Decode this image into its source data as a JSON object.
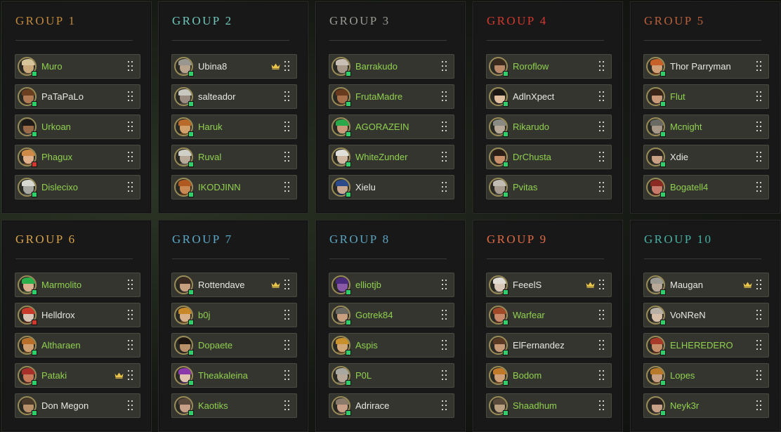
{
  "colors": {
    "online": "#2ed06a",
    "away": "#d03a2e",
    "name_green": "#8fd14f",
    "name_white": "#e8e8e2",
    "crown": "#e8c34a"
  },
  "groups": [
    {
      "title": "GROUP 1",
      "color": "#c0883a",
      "members": [
        {
          "name": "Muro",
          "highlight": true,
          "status": "online",
          "leader": false,
          "face": "#c9a97c",
          "hair": "#d8c49a",
          "body": "#5a4a36"
        },
        {
          "name": "PaTaPaLo",
          "highlight": false,
          "status": "online",
          "leader": false,
          "face": "#b07a54",
          "hair": "#6b3f22",
          "body": "#3a2e24"
        },
        {
          "name": "Urkoan",
          "highlight": true,
          "status": "online",
          "leader": false,
          "face": "#9a6a48",
          "hair": "#1e1a18",
          "body": "#3a3a3a"
        },
        {
          "name": "Phagux",
          "highlight": true,
          "status": "away",
          "leader": false,
          "face": "#e0b08a",
          "hair": "#d08a48",
          "body": "#6a4a2a"
        },
        {
          "name": "Dislecixo",
          "highlight": true,
          "status": "online",
          "leader": false,
          "face": "#a8a8a2",
          "hair": "#d8d8d2",
          "body": "#4a4a4a"
        }
      ]
    },
    {
      "title": "GROUP 2",
      "color": "#6fc6ba",
      "members": [
        {
          "name": "Ubina8",
          "highlight": false,
          "status": "online",
          "leader": true,
          "face": "#b8a48c",
          "hair": "#9a9690",
          "body": "#5a5248"
        },
        {
          "name": "salteador",
          "highlight": false,
          "status": "online",
          "leader": false,
          "face": "#9a8c80",
          "hair": "#c8c8c0",
          "body": "#4a4840"
        },
        {
          "name": "Haruk",
          "highlight": true,
          "status": "online",
          "leader": false,
          "face": "#d2a06a",
          "hair": "#b86a2a",
          "body": "#6a4a22"
        },
        {
          "name": "Ruval",
          "highlight": true,
          "status": "online",
          "leader": false,
          "face": "#b8a898",
          "hair": "#d0d0c8",
          "body": "#5a5850"
        },
        {
          "name": "IKODJINN",
          "highlight": true,
          "status": "online",
          "leader": false,
          "face": "#c88a52",
          "hair": "#b05a22",
          "body": "#6a3a1a"
        }
      ]
    },
    {
      "title": "GROUP 3",
      "color": "#9a9a94",
      "members": [
        {
          "name": "Barrakudo",
          "highlight": true,
          "status": "online",
          "leader": false,
          "face": "#a89888",
          "hair": "#c8c0b4",
          "body": "#4a443c"
        },
        {
          "name": "FrutaMadre",
          "highlight": true,
          "status": "online",
          "leader": false,
          "face": "#a8704a",
          "hair": "#6a3a1e",
          "body": "#4a3424"
        },
        {
          "name": "AGORAZEIN",
          "highlight": true,
          "status": "online",
          "leader": false,
          "face": "#c89a7a",
          "hair": "#2aa84a",
          "body": "#3a4a34"
        },
        {
          "name": "WhiteZunder",
          "highlight": true,
          "status": "online",
          "leader": false,
          "face": "#d0b8a0",
          "hair": "#e0e0da",
          "body": "#5a5a52"
        },
        {
          "name": "Xielu",
          "highlight": false,
          "status": "online",
          "leader": false,
          "face": "#c8a890",
          "hair": "#2a4a8a",
          "body": "#1e2e5a"
        }
      ]
    },
    {
      "title": "GROUP 4",
      "color": "#d3382e",
      "members": [
        {
          "name": "Roroflow",
          "highlight": true,
          "status": "online",
          "leader": false,
          "face": "#b88a6a",
          "hair": "#3a2a1e",
          "body": "#3a3230"
        },
        {
          "name": "AdlnXpect",
          "highlight": false,
          "status": "online",
          "leader": false,
          "face": "#e0c0a0",
          "hair": "#1a1614",
          "body": "#2a2624"
        },
        {
          "name": "Rikarudo",
          "highlight": true,
          "status": "online",
          "leader": false,
          "face": "#b8a898",
          "hair": "#8a8a84",
          "body": "#4a4a44"
        },
        {
          "name": "DrChusta",
          "highlight": true,
          "status": "online",
          "leader": false,
          "face": "#c8906a",
          "hair": "#2a1e16",
          "body": "#3a2a20"
        },
        {
          "name": "Pvitas",
          "highlight": true,
          "status": "online",
          "leader": false,
          "face": "#a89c90",
          "hair": "#c0bcb4",
          "body": "#4a4844"
        }
      ]
    },
    {
      "title": "GROUP 5",
      "color": "#b8603a",
      "members": [
        {
          "name": "Thor Parryman",
          "highlight": false,
          "status": "online",
          "leader": false,
          "face": "#d0a078",
          "hair": "#c8602a",
          "body": "#6a3a1a"
        },
        {
          "name": "Flut",
          "highlight": true,
          "status": "online",
          "leader": false,
          "face": "#c89a7a",
          "hair": "#3a2418",
          "body": "#3a2e26"
        },
        {
          "name": "Mcnight",
          "highlight": true,
          "status": "online",
          "leader": false,
          "face": "#a89888",
          "hair": "#6a6a64",
          "body": "#4a4640"
        },
        {
          "name": "Xdie",
          "highlight": false,
          "status": "online",
          "leader": false,
          "face": "#c8a084",
          "hair": "#2a2420",
          "body": "#3a3430"
        },
        {
          "name": "Bogatell4",
          "highlight": true,
          "status": "online",
          "leader": false,
          "face": "#c87a6a",
          "hair": "#8a2a22",
          "body": "#5a2420"
        }
      ]
    },
    {
      "title": "GROUP 6",
      "color": "#d8a24a",
      "members": [
        {
          "name": "Marmolito",
          "highlight": true,
          "status": "online",
          "leader": false,
          "face": "#d8b090",
          "hair": "#2ab04a",
          "body": "#4a5a3a"
        },
        {
          "name": "Helldrox",
          "highlight": false,
          "status": "away",
          "leader": false,
          "face": "#d8c4b4",
          "hair": "#c83a2a",
          "body": "#5a2a22"
        },
        {
          "name": "Altharaen",
          "highlight": true,
          "status": "online",
          "leader": false,
          "face": "#d0a070",
          "hair": "#b8702a",
          "body": "#6a4a24"
        },
        {
          "name": "Pataki",
          "highlight": true,
          "status": "online",
          "leader": true,
          "face": "#c87a5a",
          "hair": "#a8302a",
          "body": "#5a2a22"
        },
        {
          "name": "Don Megon",
          "highlight": false,
          "status": "online",
          "leader": false,
          "face": "#b8906a",
          "hair": "#4a3a2a",
          "body": "#3a3028"
        }
      ]
    },
    {
      "title": "GROUP 7",
      "color": "#5aa8c8",
      "members": [
        {
          "name": "Rottendave",
          "highlight": false,
          "status": "online",
          "leader": true,
          "face": "#c8a080",
          "hair": "#3a2a22",
          "body": "#3a302a"
        },
        {
          "name": "b0j",
          "highlight": true,
          "status": "online",
          "leader": false,
          "face": "#d8b08a",
          "hair": "#c8882a",
          "body": "#6a4a24"
        },
        {
          "name": "Dopaete",
          "highlight": true,
          "status": "online",
          "leader": false,
          "face": "#b8906a",
          "hair": "#1e1612",
          "body": "#2a2420"
        },
        {
          "name": "Theakaleina",
          "highlight": true,
          "status": "online",
          "leader": false,
          "face": "#e0c4b0",
          "hair": "#8a3aaa",
          "body": "#4a2a5a"
        },
        {
          "name": "Kaotiks",
          "highlight": true,
          "status": "online",
          "leader": false,
          "face": "#c8a088",
          "hair": "#5a4a3e",
          "body": "#3a3430"
        }
      ]
    },
    {
      "title": "GROUP 8",
      "color": "#5aa4c0",
      "members": [
        {
          "name": "elliotjb",
          "highlight": true,
          "status": "online",
          "leader": false,
          "face": "#8a5aa8",
          "hair": "#4a2a7a",
          "body": "#2a1e44"
        },
        {
          "name": "Gotrek84",
          "highlight": true,
          "status": "online",
          "leader": false,
          "face": "#c8a080",
          "hair": "#6a6a62",
          "body": "#4a4640"
        },
        {
          "name": "Aspis",
          "highlight": true,
          "status": "online",
          "leader": false,
          "face": "#d0a878",
          "hair": "#c8902a",
          "body": "#6a4a24"
        },
        {
          "name": "P0L",
          "highlight": true,
          "status": "online",
          "leader": false,
          "face": "#b8a898",
          "hair": "#a8a8a0",
          "body": "#5a5650"
        },
        {
          "name": "Adrirace",
          "highlight": false,
          "status": "online",
          "leader": false,
          "face": "#c8a088",
          "hair": "#8a7a6a",
          "body": "#4a4038"
        }
      ]
    },
    {
      "title": "GROUP 9",
      "color": "#e06a44",
      "members": [
        {
          "name": "FeeelS",
          "highlight": false,
          "status": "online",
          "leader": true,
          "face": "#d8c8b8",
          "hair": "#e0dcd4",
          "body": "#5a5650"
        },
        {
          "name": "Warfear",
          "highlight": true,
          "status": "online",
          "leader": false,
          "face": "#c88a6a",
          "hair": "#a04a2a",
          "body": "#5a3022"
        },
        {
          "name": "ElFernandez",
          "highlight": false,
          "status": "online",
          "leader": false,
          "face": "#c89a78",
          "hair": "#5a3a24",
          "body": "#3a3028"
        },
        {
          "name": "Bodom",
          "highlight": true,
          "status": "online",
          "leader": false,
          "face": "#d0a078",
          "hair": "#c07a2a",
          "body": "#6a4424"
        },
        {
          "name": "Shaadhum",
          "highlight": true,
          "status": "online",
          "leader": false,
          "face": "#b8a080",
          "hair": "#5a4a3a",
          "body": "#3e3630"
        }
      ]
    },
    {
      "title": "GROUP 10",
      "color": "#48b0a2",
      "members": [
        {
          "name": "Maugan",
          "highlight": false,
          "status": "online",
          "leader": true,
          "face": "#b8a898",
          "hair": "#9a9a92",
          "body": "#4a4844"
        },
        {
          "name": "VoNReN",
          "highlight": false,
          "status": "online",
          "leader": false,
          "face": "#d8c0a8",
          "hair": "#b8b0a4",
          "body": "#4a4440"
        },
        {
          "name": "ELHEREDERO",
          "highlight": true,
          "status": "online",
          "leader": false,
          "face": "#c8906a",
          "hair": "#a83a2a",
          "body": "#5a2a22"
        },
        {
          "name": "Lopes",
          "highlight": true,
          "status": "online",
          "leader": false,
          "face": "#c8a084",
          "hair": "#b87a2a",
          "body": "#5a4024"
        },
        {
          "name": "Neyk3r",
          "highlight": true,
          "status": "online",
          "leader": false,
          "face": "#c8a088",
          "hair": "#2a2220",
          "body": "#3a3230"
        }
      ]
    }
  ]
}
